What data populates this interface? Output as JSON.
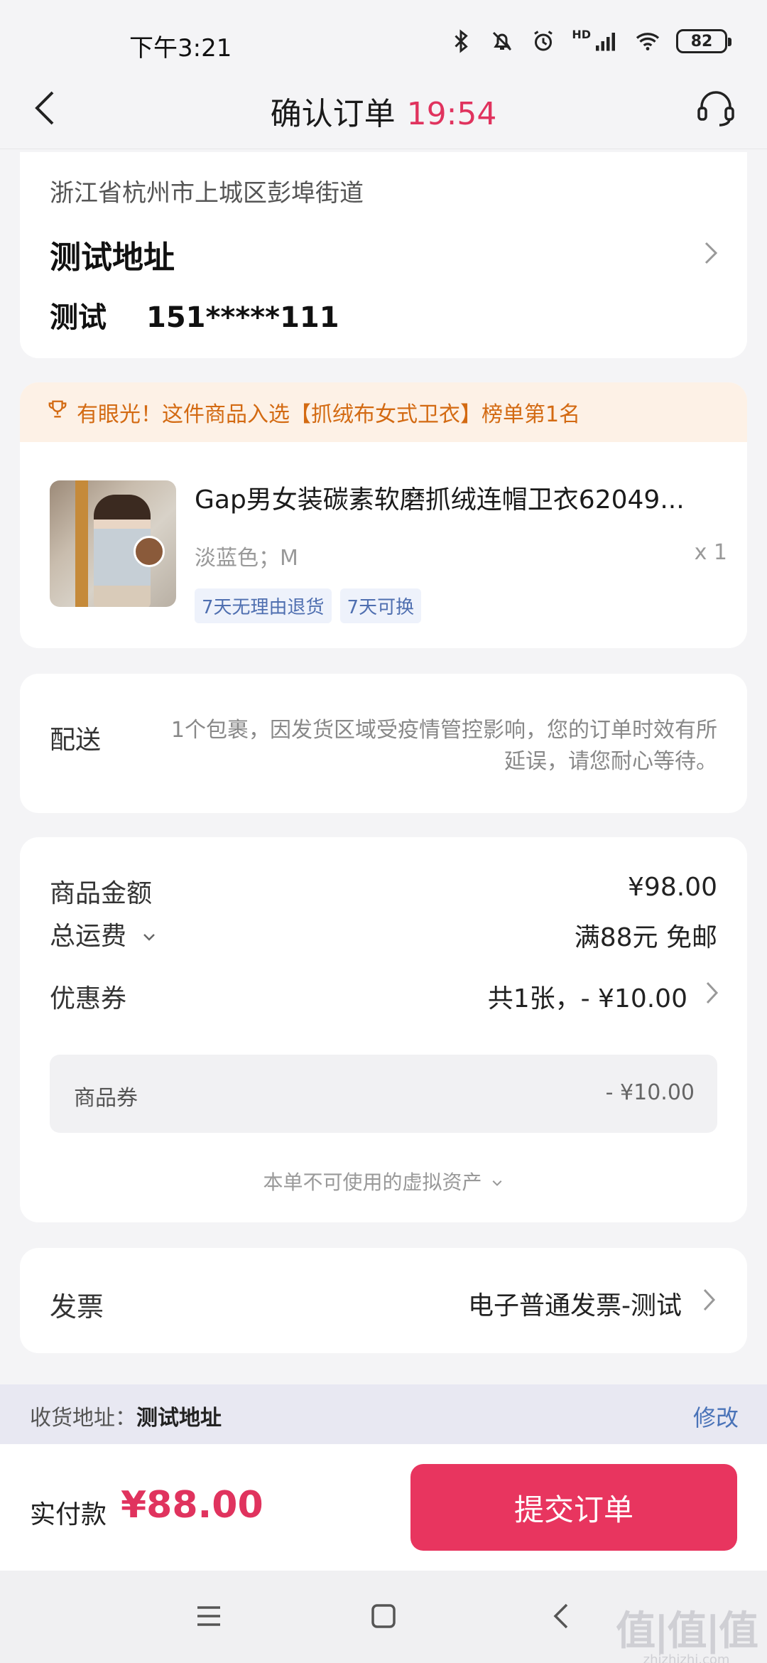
{
  "status_bar": {
    "time": "下午3:21",
    "network": "HD",
    "battery": "82"
  },
  "header": {
    "title": "确认订单",
    "countdown": "19:54"
  },
  "address": {
    "region": "浙江省杭州市上城区彭埠街道",
    "name": "测试地址",
    "contact_name": "测试",
    "phone": "151*****111"
  },
  "rank_banner": {
    "text": "有眼光！这件商品入选【抓绒布女式卫衣】榜单第1名"
  },
  "product": {
    "title": "Gap男女装碳素软磨抓绒连帽卫衣62049...",
    "spec": "淡蓝色；M",
    "quantity": "x 1",
    "tags": [
      "7天无理由退货",
      "7天可换"
    ]
  },
  "delivery": {
    "label": "配送",
    "line1": "1个包裹，因发货区域受疫情管控影响，您的订单时效有所",
    "line2": "延误，请您耐心等待。"
  },
  "price": {
    "goods_label": "商品金额",
    "goods_value": "¥98.00",
    "shipping_label": "总运费",
    "shipping_value": "满88元 免邮",
    "coupon_label": "优惠券",
    "coupon_value": "共1张，- ¥10.00",
    "coupon_detail_label": "商品券",
    "coupon_detail_value": "- ¥10.00",
    "virtual_assets": "本单不可使用的虚拟资产"
  },
  "invoice": {
    "label": "发票",
    "value": "电子普通发票-测试"
  },
  "address_strip": {
    "label": "收货地址：",
    "value": "测试地址",
    "edit": "修改"
  },
  "bottom": {
    "pay_label": "实付款",
    "pay_amount": "¥88.00",
    "submit": "提交订单"
  },
  "watermark": {
    "main": "值|值|值",
    "sub": "zhizhizhi.com"
  },
  "colors": {
    "accent": "#e8355f",
    "countdown": "#e0335e",
    "rank_text": "#d36a12",
    "rank_bg": "#fdf1e6",
    "tag_text": "#4f6fb0",
    "link": "#4a73b8"
  }
}
